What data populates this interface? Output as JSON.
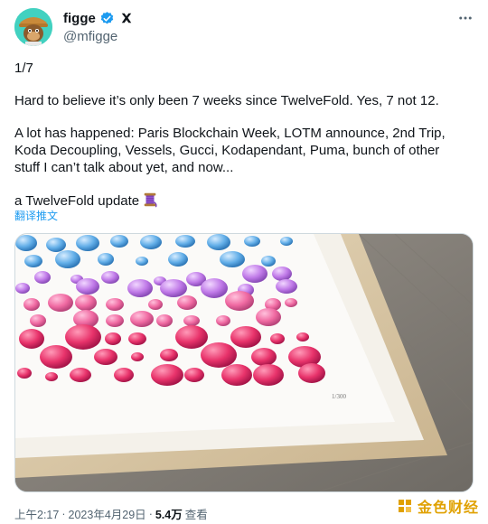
{
  "author": {
    "display_name": "figge",
    "handle": "@mfigge"
  },
  "more_icon": "more-horizontal-icon",
  "tweet": {
    "counter": "1/7",
    "line_2": "Hard to believe it’s only been 7 weeks since TwelveFold.  Yes, 7 not 12.",
    "line_3": "A lot has happened: Paris Blockchain Week, LOTM announce, 2nd Trip,",
    "line_4": "Koda Decoupling, Vessels, Gucci, Kodapendant, Puma, bunch of other",
    "line_5": "stuff I can’t talk about yet, and now...",
    "line_6": "a TwelveFold update"
  },
  "translate_label": "翻译推文",
  "meta": {
    "time": "上午2:17",
    "separator": "·",
    "date": "2023年4月29日",
    "separator2": "·",
    "views_count": "5.4万",
    "views_label": "查看"
  },
  "watermark": {
    "text": "金色财经"
  },
  "colors": {
    "accent": "#1d9bf0",
    "secondary_text": "#536471",
    "watermark": "#e0a100"
  }
}
